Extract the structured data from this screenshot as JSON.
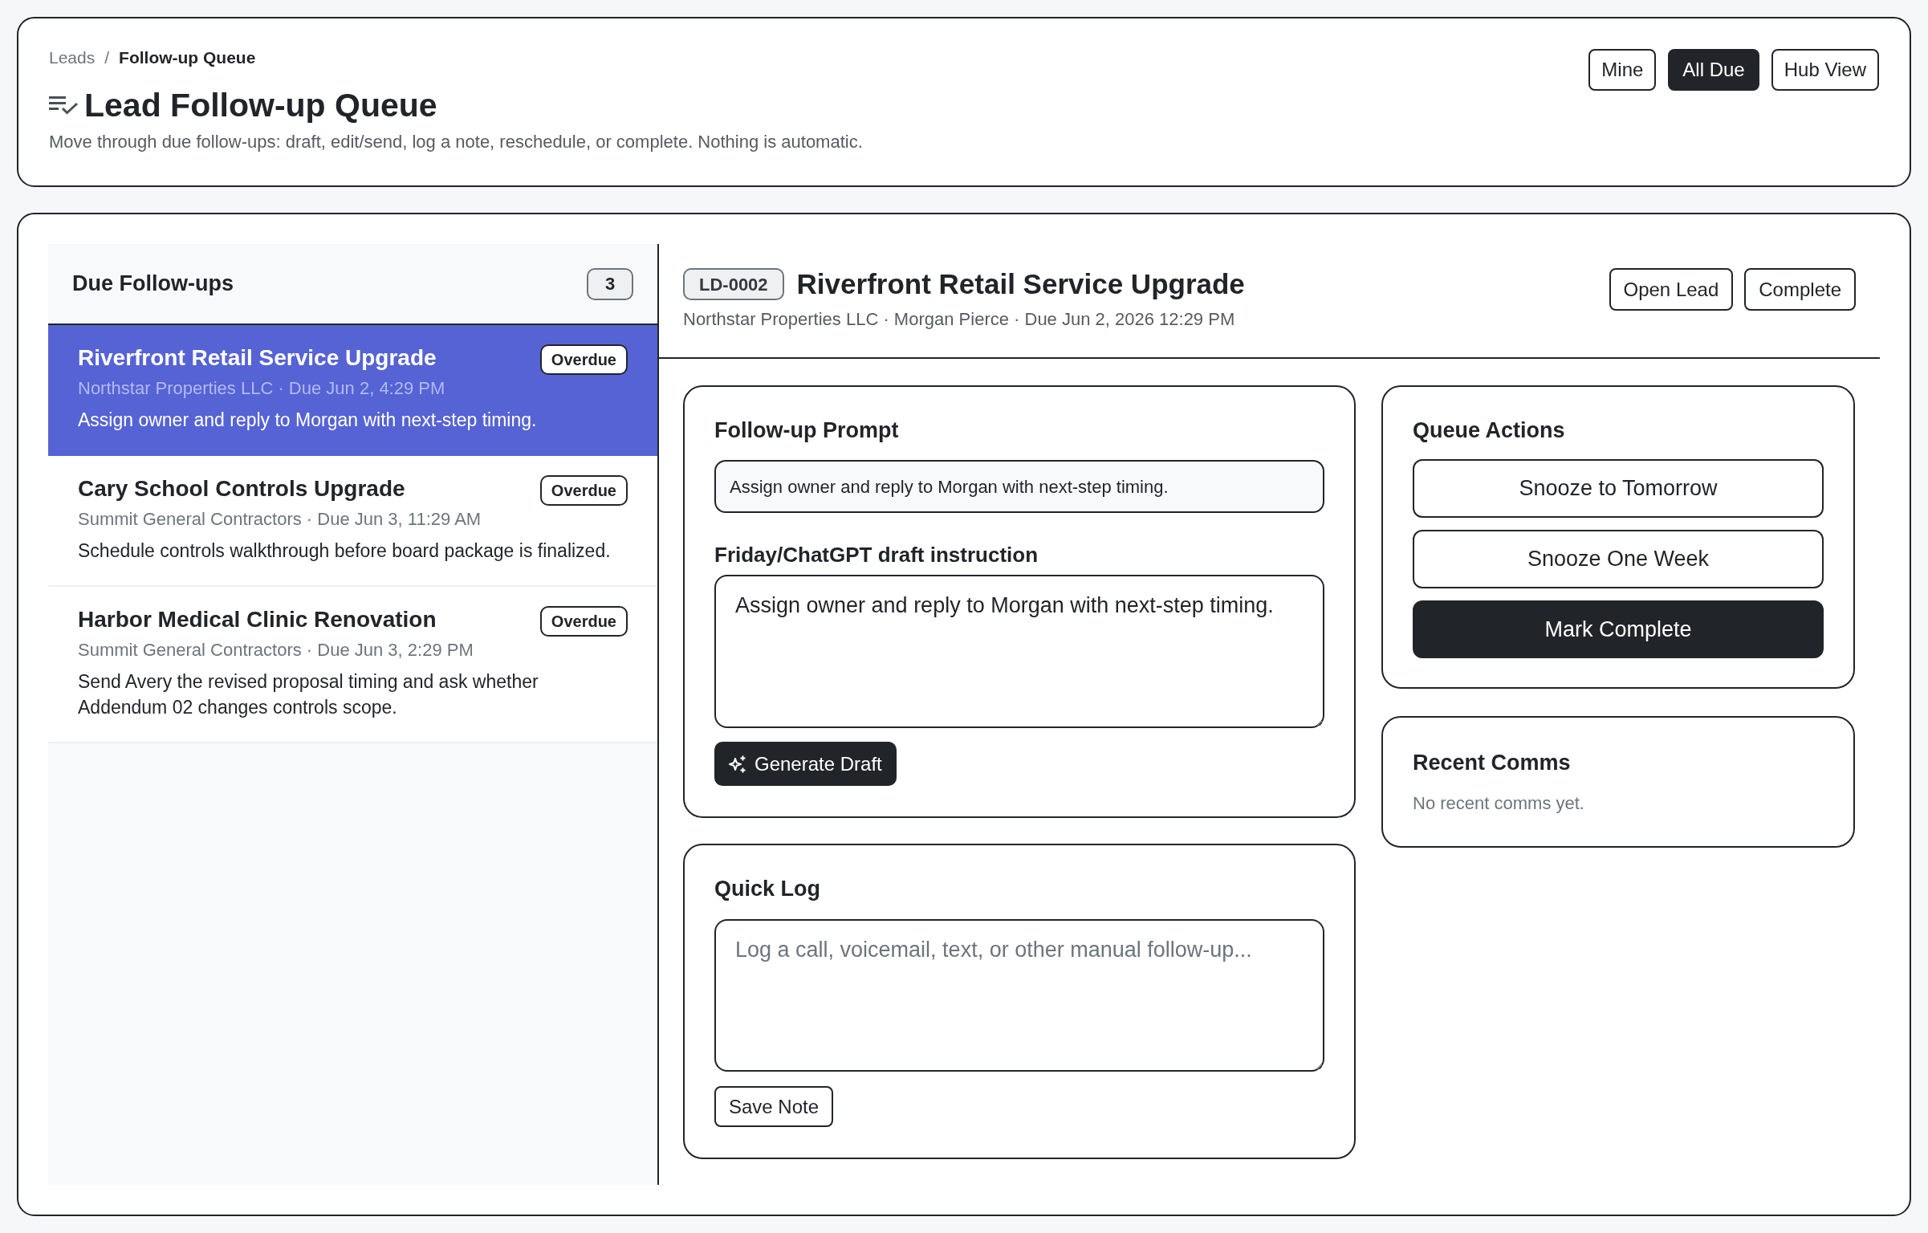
{
  "breadcrumb": {
    "separator": "/",
    "items": [
      {
        "label": "Leads",
        "current": false
      },
      {
        "label": "Follow-up Queue",
        "current": true
      }
    ]
  },
  "page": {
    "title": "Lead Follow-up Queue",
    "subtitle": "Move through due follow-ups: draft, edit/send, log a note, reschedule, or complete. Nothing is automatic."
  },
  "view_tabs": [
    {
      "label": "Mine",
      "selected": false
    },
    {
      "label": "All Due",
      "selected": true
    },
    {
      "label": "Hub View",
      "selected": false
    }
  ],
  "queue": {
    "title": "Due Follow-ups",
    "count": "3",
    "items": [
      {
        "title": "Riverfront Retail Service Upgrade",
        "meta": "Northstar Properties LLC · Due Jun 2, 4:29 PM",
        "note": "Assign owner and reply to Morgan with next-step timing.",
        "badge": "Overdue",
        "selected": true
      },
      {
        "title": "Cary School Controls Upgrade",
        "meta": "Summit General Contractors · Due Jun 3, 11:29 AM",
        "note": "Schedule controls walkthrough before board package is finalized.",
        "badge": "Overdue",
        "selected": false
      },
      {
        "title": "Harbor Medical Clinic Renovation",
        "meta": "Summit General Contractors · Due Jun 3, 2:29 PM",
        "note": "Send Avery the revised proposal timing and ask whether Addendum 02 changes controls scope.",
        "badge": "Overdue",
        "selected": false
      }
    ]
  },
  "detail": {
    "id": "LD-0002",
    "title": "Riverfront Retail Service Upgrade",
    "meta": "Northstar Properties LLC · Morgan Pierce · Due Jun 2, 2026 12:29 PM",
    "buttons": [
      "Open Lead",
      "Complete"
    ],
    "prompt_card": {
      "title": "Follow-up Prompt",
      "prompt": "Assign owner and reply to Morgan with next-step timing.",
      "draft_label": "Friday/ChatGPT draft instruction",
      "draft_value": "Assign owner and reply to Morgan with next-step timing.",
      "generate_button": "Generate Draft"
    },
    "quick_log": {
      "title": "Quick Log",
      "placeholder": "Log a call, voicemail, text, or other manual follow-up...",
      "save_button": "Save Note"
    },
    "queue_actions": {
      "title": "Queue Actions",
      "buttons": [
        {
          "label": "Snooze to Tomorrow",
          "kind": "outline"
        },
        {
          "label": "Snooze One Week",
          "kind": "outline"
        },
        {
          "label": "Mark Complete",
          "kind": "primary"
        }
      ]
    },
    "recent_comms": {
      "title": "Recent Comms",
      "empty_text": "No recent comms yet."
    }
  }
}
